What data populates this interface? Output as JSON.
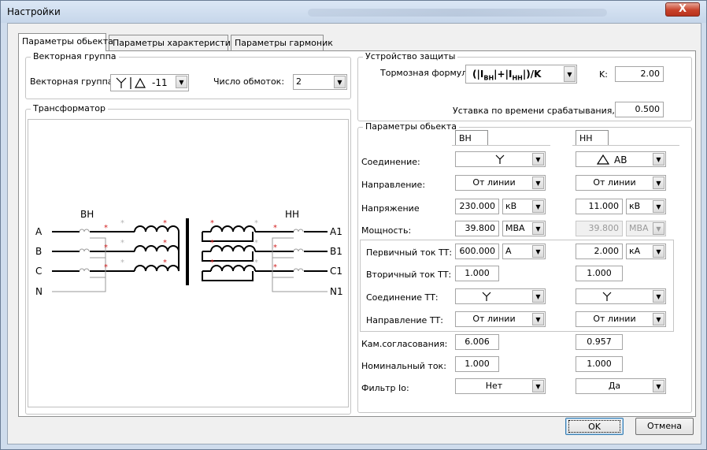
{
  "window": {
    "title": "Настройки",
    "close_glyph": "X"
  },
  "tabs": [
    "Параметры обьекта",
    "Параметры характеристики",
    "Параметры гармоник"
  ],
  "vector_group": {
    "group_label": "Векторная группа",
    "field_label": "Векторная группа:",
    "value_suffix": "-11",
    "windings_label": "Число обмоток:",
    "windings_value": "2"
  },
  "transformer": {
    "group_label": "Трансформатор",
    "hv_label": "ВН",
    "lv_label": "НН",
    "hv_phases": [
      "A",
      "B",
      "C",
      "N"
    ],
    "lv_phases": [
      "A1",
      "B1",
      "C1",
      "N1"
    ]
  },
  "protection": {
    "group_label": "Устройство защиты",
    "formula_label": "Тормозная формула:",
    "formula": {
      "open": "(|I",
      "sub1": "ВН",
      "mid": "|+|I",
      "sub2": "НН",
      "close": "|)/K"
    },
    "k_label": "K:",
    "k_value": "2.00",
    "delay_label": "Уставка по времени срабатывания, с:",
    "delay_value": "0.500"
  },
  "object_params": {
    "group_label": "Параметры обьекта",
    "hv_tab": "ВН",
    "lv_tab": "НН",
    "rows": {
      "connection": {
        "label": "Соединение:",
        "lv_text": "AB"
      },
      "direction": {
        "label": "Направление:",
        "hv": "От линии",
        "lv": "От линии"
      },
      "voltage": {
        "label": "Напряжение",
        "hv": "230.000",
        "hv_unit": "кВ",
        "lv": "11.000",
        "lv_unit": "кВ"
      },
      "power": {
        "label": "Мощность:",
        "hv": "39.800",
        "hv_unit": "МВА",
        "lv": "39.800",
        "lv_unit": "МВА"
      },
      "ct_primary": {
        "label": "Первичный ток ТТ:",
        "hv": "600.000",
        "hv_unit": "А",
        "lv": "2.000",
        "lv_unit": "кА"
      },
      "ct_secondary": {
        "label": "Вторичный ток ТТ:",
        "hv": "1.000",
        "lv": "1.000"
      },
      "ct_connection": {
        "label": "Соединение ТТ:"
      },
      "ct_direction": {
        "label": "Направление ТТ:",
        "hv": "От линии",
        "lv": "От линии"
      },
      "matching": {
        "label": "Кам.согласования:",
        "hv": "6.006",
        "lv": "0.957"
      },
      "nominal": {
        "label": "Номинальный ток:",
        "hv": "1.000",
        "lv": "1.000"
      },
      "filter": {
        "label": "Фильтр Io:",
        "hv": "Нет",
        "lv": "Да"
      }
    }
  },
  "buttons": {
    "ok": "OK",
    "cancel": "Отмена"
  },
  "colors": {
    "marker": "#d21f1f",
    "ghost_marker": "#b5b5b5",
    "frame": "#cfdcec",
    "close": "#c7412a"
  }
}
